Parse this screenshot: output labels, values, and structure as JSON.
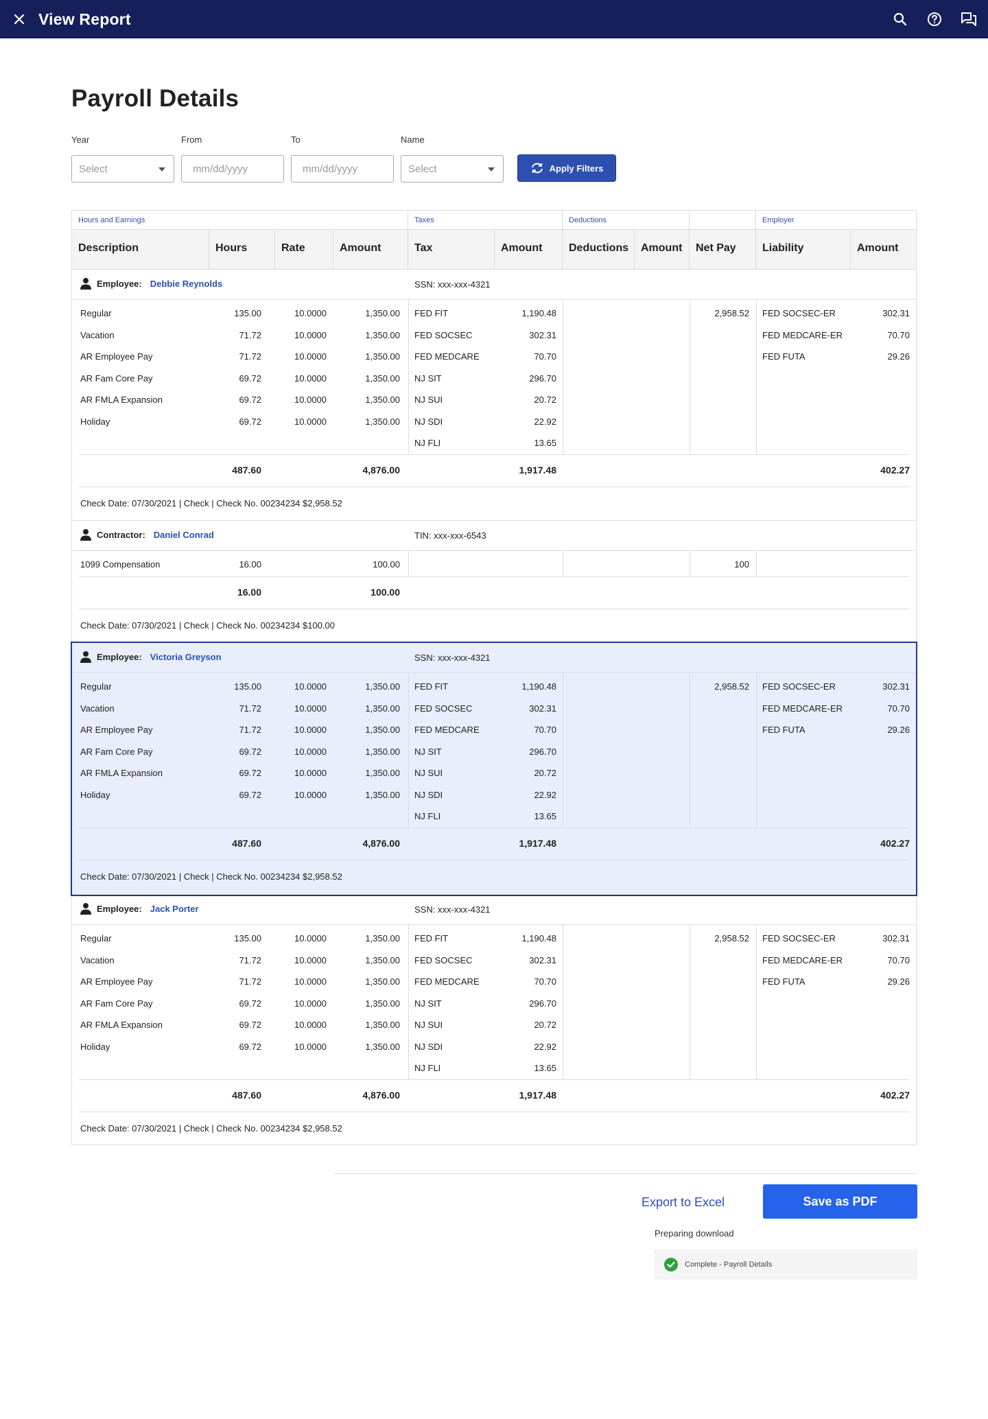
{
  "topbar": {
    "title": "View Report"
  },
  "page": {
    "title": "Payroll Details"
  },
  "filters": {
    "year_label": "Year",
    "year_value": "Select",
    "from_label": "From",
    "from_placeholder": "mm/dd/yyyy",
    "to_label": "To",
    "to_placeholder": "mm/dd/yyyy",
    "name_label": "Name",
    "name_value": "Select",
    "apply_label": "Apply Filters"
  },
  "groups": {
    "hours": "Hours and Earnings",
    "taxes": "Taxes",
    "deductions": "Deductions",
    "employer": "Employer"
  },
  "columns": {
    "description": "Description",
    "hours": "Hours",
    "rate": "Rate",
    "amount": "Amount",
    "tax": "Tax",
    "tax_amount": "Amount",
    "deductions": "Deductions",
    "ded_amount": "Amount",
    "net_pay": "Net Pay",
    "liability": "Liability",
    "liab_amount": "Amount"
  },
  "sections": [
    {
      "role": "Employee:",
      "name": "Debbie Reynolds",
      "id": "SSN: xxx-xxx-4321",
      "earnings": [
        {
          "d": "Regular",
          "h": "135.00",
          "r": "10.0000",
          "a": "1,350.00"
        },
        {
          "d": "Vacation",
          "h": "71.72",
          "r": "10.0000",
          "a": "1,350.00"
        },
        {
          "d": "AR Employee Pay",
          "h": "71.72",
          "r": "10.0000",
          "a": "1,350.00"
        },
        {
          "d": "AR Fam Core Pay",
          "h": "69.72",
          "r": "10.0000",
          "a": "1,350.00"
        },
        {
          "d": "AR FMLA Expansion",
          "h": "69.72",
          "r": "10.0000",
          "a": "1,350.00"
        },
        {
          "d": "Holiday",
          "h": "69.72",
          "r": "10.0000",
          "a": "1,350.00"
        }
      ],
      "taxes": [
        {
          "t": "FED FIT",
          "a": "1,190.48"
        },
        {
          "t": "FED SOCSEC",
          "a": "302.31"
        },
        {
          "t": "FED MEDCARE",
          "a": "70.70"
        },
        {
          "t": "NJ SIT",
          "a": "296.70"
        },
        {
          "t": "NJ SUI",
          "a": "20.72"
        },
        {
          "t": "NJ SDI",
          "a": "22.92"
        },
        {
          "t": "NJ FLI",
          "a": "13.65"
        }
      ],
      "net_pay": "2,958.52",
      "liabilities": [
        {
          "l": "FED SOCSEC-ER",
          "a": "302.31"
        },
        {
          "l": "FED MEDCARE-ER",
          "a": "70.70"
        },
        {
          "l": "FED FUTA",
          "a": "29.26"
        }
      ],
      "totals": {
        "hours": "487.60",
        "amount": "4,876.00",
        "tax": "1,917.48",
        "liab": "402.27"
      },
      "footer": "Check Date: 07/30/2021  |  Check  |  Check No. 00234234 $2,958.52"
    },
    {
      "role": "Contractor:",
      "name": "Daniel Conrad",
      "id": "TIN: xxx-xxx-6543",
      "earnings": [
        {
          "d": "1099 Compensation",
          "h": "16.00",
          "r": "",
          "a": "100.00"
        }
      ],
      "taxes": [],
      "net_pay": "100",
      "liabilities": [],
      "totals": {
        "hours": "16.00",
        "amount": "100.00",
        "tax": "",
        "liab": ""
      },
      "footer": "Check Date: 07/30/2021  |  Check  |  Check No. 00234234 $100.00"
    },
    {
      "role": "Employee:",
      "name": "Victoria Greyson",
      "id": "SSN: xxx-xxx-4321",
      "earnings": [
        {
          "d": "Regular",
          "h": "135.00",
          "r": "10.0000",
          "a": "1,350.00"
        },
        {
          "d": "Vacation",
          "h": "71.72",
          "r": "10.0000",
          "a": "1,350.00"
        },
        {
          "d": "AR Employee Pay",
          "h": "71.72",
          "r": "10.0000",
          "a": "1,350.00"
        },
        {
          "d": "AR Fam Core Pay",
          "h": "69.72",
          "r": "10.0000",
          "a": "1,350.00"
        },
        {
          "d": "AR FMLA Expansion",
          "h": "69.72",
          "r": "10.0000",
          "a": "1,350.00"
        },
        {
          "d": "Holiday",
          "h": "69.72",
          "r": "10.0000",
          "a": "1,350.00"
        }
      ],
      "taxes": [
        {
          "t": "FED FIT",
          "a": "1,190.48"
        },
        {
          "t": "FED SOCSEC",
          "a": "302.31"
        },
        {
          "t": "FED MEDCARE",
          "a": "70.70"
        },
        {
          "t": "NJ SIT",
          "a": "296.70"
        },
        {
          "t": "NJ SUI",
          "a": "20.72"
        },
        {
          "t": "NJ SDI",
          "a": "22.92"
        },
        {
          "t": "NJ FLI",
          "a": "13.65"
        }
      ],
      "net_pay": "2,958.52",
      "liabilities": [
        {
          "l": "FED SOCSEC-ER",
          "a": "302.31"
        },
        {
          "l": "FED MEDCARE-ER",
          "a": "70.70"
        },
        {
          "l": "FED FUTA",
          "a": "29.26"
        }
      ],
      "totals": {
        "hours": "487.60",
        "amount": "4,876.00",
        "tax": "1,917.48",
        "liab": "402.27"
      },
      "footer": "Check Date: 07/30/2021  |  Check  |  Check No. 00234234 $2,958.52"
    },
    {
      "role": "Employee:",
      "name": "Jack Porter",
      "id": "SSN: xxx-xxx-4321",
      "earnings": [
        {
          "d": "Regular",
          "h": "135.00",
          "r": "10.0000",
          "a": "1,350.00"
        },
        {
          "d": "Vacation",
          "h": "71.72",
          "r": "10.0000",
          "a": "1,350.00"
        },
        {
          "d": "AR Employee Pay",
          "h": "71.72",
          "r": "10.0000",
          "a": "1,350.00"
        },
        {
          "d": "AR Fam Core Pay",
          "h": "69.72",
          "r": "10.0000",
          "a": "1,350.00"
        },
        {
          "d": "AR FMLA Expansion",
          "h": "69.72",
          "r": "10.0000",
          "a": "1,350.00"
        },
        {
          "d": "Holiday",
          "h": "69.72",
          "r": "10.0000",
          "a": "1,350.00"
        }
      ],
      "taxes": [
        {
          "t": "FED FIT",
          "a": "1,190.48"
        },
        {
          "t": "FED SOCSEC",
          "a": "302.31"
        },
        {
          "t": "FED MEDCARE",
          "a": "70.70"
        },
        {
          "t": "NJ SIT",
          "a": "296.70"
        },
        {
          "t": "NJ SUI",
          "a": "20.72"
        },
        {
          "t": "NJ SDI",
          "a": "22.92"
        },
        {
          "t": "NJ FLI",
          "a": "13.65"
        }
      ],
      "net_pay": "2,958.52",
      "liabilities": [
        {
          "l": "FED SOCSEC-ER",
          "a": "302.31"
        },
        {
          "l": "FED MEDCARE-ER",
          "a": "70.70"
        },
        {
          "l": "FED FUTA",
          "a": "29.26"
        }
      ],
      "totals": {
        "hours": "487.60",
        "amount": "4,876.00",
        "tax": "1,917.48",
        "liab": "402.27"
      },
      "footer": "Check Date: 07/30/2021  |  Check  |  Check No. 00234234 $2,958.52"
    }
  ],
  "actions": {
    "export_label": "Export to Excel",
    "save_pdf_label": "Save as PDF",
    "preparing_label": "Preparing download",
    "complete_label": "Complete - Payroll Details"
  },
  "icons": {
    "close": "close-icon",
    "search": "search-icon",
    "help": "help-icon",
    "chat": "chat-icon",
    "person": "person-icon",
    "refresh": "refresh-icon",
    "check": "check-circle-icon"
  },
  "colors": {
    "topbar": "#15205a",
    "accent": "#2d4fb0",
    "primary_button": "#2563eb",
    "selected_row": "#e8eefb",
    "success": "#2ea043"
  }
}
